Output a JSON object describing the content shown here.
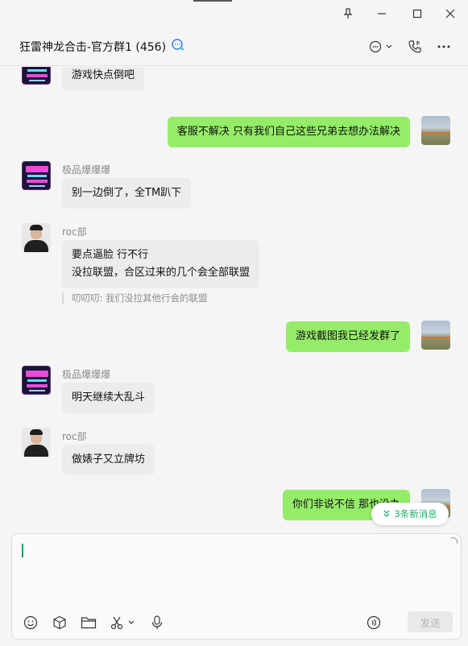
{
  "window": {
    "pin_icon": "pin-icon",
    "minimize_icon": "minimize-icon",
    "maximize_icon": "maximize-icon",
    "close_icon": "close-icon"
  },
  "header": {
    "title": "狂雷神龙合击-官方群1 (456)",
    "chat_icon": "chat-bubble-icon",
    "call_icon": "phone-icon",
    "more_icon": "more-icon"
  },
  "messages": [
    {
      "id": "m1",
      "side": "in",
      "sender": "",
      "text": "游戏快点倒吧",
      "avatar": "neon"
    },
    {
      "id": "m2",
      "side": "out",
      "text": "客服不解决 只有我们自己这些兄弟去想办法解决",
      "avatar": "land"
    },
    {
      "id": "m3",
      "side": "in",
      "sender": "极品爆爆爆",
      "text": "别一边倒了，全TM趴下",
      "avatar": "neon"
    },
    {
      "id": "m4",
      "side": "in",
      "sender": "roc部",
      "text_lines": [
        "要点逼脸  行不行",
        "没拉联盟，合区过来的几个会全部联盟"
      ],
      "quote": "叨叨叨: 我们没拉其他行会的联盟",
      "avatar": "photo"
    },
    {
      "id": "m5",
      "side": "out",
      "text": "游戏截图我已经发群了",
      "avatar": "land"
    },
    {
      "id": "m6",
      "side": "in",
      "sender": "极品爆爆爆",
      "text": "明天继续大乱斗",
      "avatar": "neon"
    },
    {
      "id": "m7",
      "side": "in",
      "sender": "roc部",
      "text": "做婊子又立牌坊",
      "avatar": "photo"
    },
    {
      "id": "m8",
      "side": "out",
      "text": "你们非说不信 那也没办",
      "avatar": "land"
    }
  ],
  "new_messages": {
    "label": "3条新消息"
  },
  "composer": {
    "value": "",
    "send_label": "发送",
    "tools": [
      "emoji-icon",
      "cube-icon",
      "folder-icon",
      "scissors-icon",
      "microphone-icon",
      "voice-input-icon"
    ]
  },
  "colors": {
    "outgoing_bubble": "#95ec69",
    "incoming_bubble": "#ececec",
    "accent": "#1aad67"
  }
}
